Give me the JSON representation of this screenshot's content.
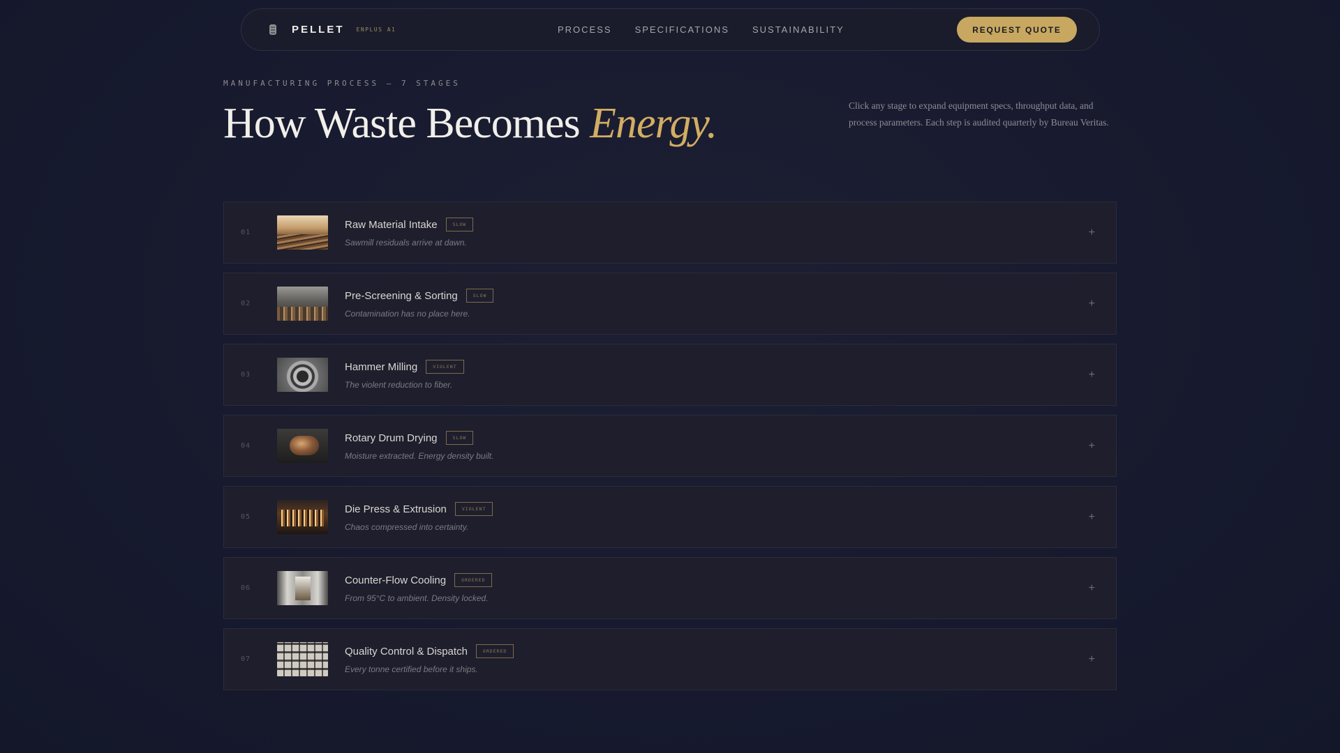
{
  "nav": {
    "brand": "PELLET",
    "tag": "ENPLUS A1",
    "links": [
      "PROCESS",
      "SPECIFICATIONS",
      "SUSTAINABILITY"
    ],
    "cta": "REQUEST QUOTE"
  },
  "hero": {
    "eyebrow": "MANUFACTURING PROCESS — 7 STAGES",
    "title": "How Waste Becomes",
    "title_accent": "Energy.",
    "description": "Click any stage to expand equipment specs, throughput data, and process parameters. Each step is audited quarterly by Bureau Veritas."
  },
  "stages": [
    {
      "num": "01",
      "title": "Raw Material Intake",
      "badge": "SLOW",
      "subtitle": "Sawmill residuals arrive at dawn."
    },
    {
      "num": "02",
      "title": "Pre-Screening & Sorting",
      "badge": "SLOW",
      "subtitle": "Contamination has no place here."
    },
    {
      "num": "03",
      "title": "Hammer Milling",
      "badge": "VIOLENT",
      "subtitle": "The violent reduction to fiber."
    },
    {
      "num": "04",
      "title": "Rotary Drum Drying",
      "badge": "SLOW",
      "subtitle": "Moisture extracted. Energy density built."
    },
    {
      "num": "05",
      "title": "Die Press & Extrusion",
      "badge": "VIOLENT",
      "subtitle": "Chaos compressed into certainty."
    },
    {
      "num": "06",
      "title": "Counter-Flow Cooling",
      "badge": "ORDERED",
      "subtitle": "From 95°C to ambient. Density locked."
    },
    {
      "num": "07",
      "title": "Quality Control & Dispatch",
      "badge": "ORDERED",
      "subtitle": "Every tonne certified before it ships."
    }
  ],
  "expand_icon": "+",
  "colors": {
    "accent": "#c8a860",
    "background": "#171a2e",
    "card": "#1f1e2d"
  }
}
